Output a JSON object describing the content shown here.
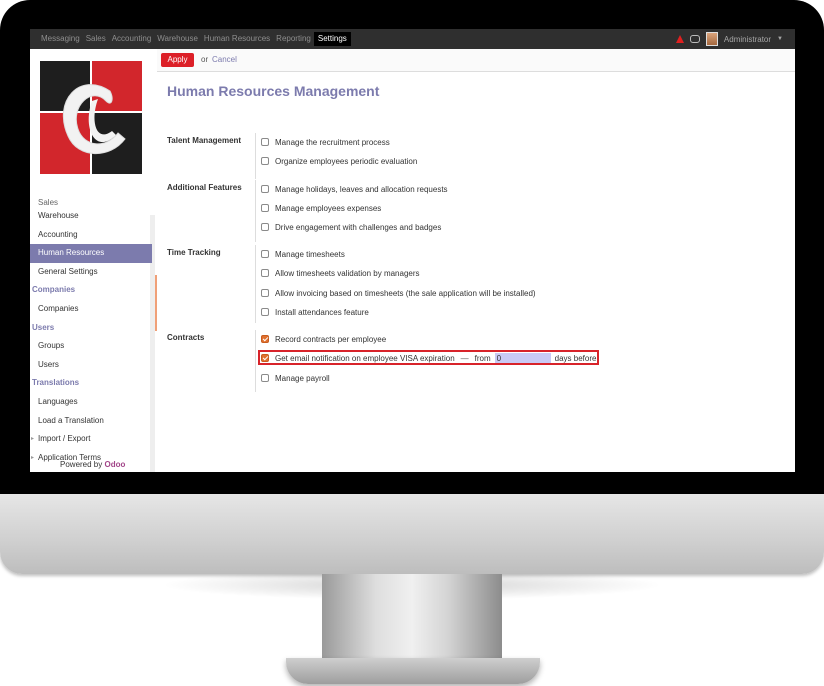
{
  "nav": {
    "menu": [
      {
        "label": "Messaging",
        "active": false
      },
      {
        "label": "Sales",
        "active": false
      },
      {
        "label": "Accounting",
        "active": false
      },
      {
        "label": "Warehouse",
        "active": false
      },
      {
        "label": "Human Resources",
        "active": false
      },
      {
        "label": "Reporting",
        "active": false
      },
      {
        "label": "Settings",
        "active": true
      }
    ],
    "user": "Administrator"
  },
  "sidebar": {
    "items": [
      {
        "label": "Sales",
        "type": "item"
      },
      {
        "label": "Warehouse",
        "type": "item"
      },
      {
        "label": "Accounting",
        "type": "item"
      },
      {
        "label": "Human Resources",
        "type": "item",
        "selected": true
      },
      {
        "label": "General Settings",
        "type": "item"
      },
      {
        "label": "Companies",
        "type": "category"
      },
      {
        "label": "Companies",
        "type": "item"
      },
      {
        "label": "Users",
        "type": "category"
      },
      {
        "label": "Groups",
        "type": "item"
      },
      {
        "label": "Users",
        "type": "item"
      },
      {
        "label": "Translations",
        "type": "category"
      },
      {
        "label": "Languages",
        "type": "item"
      },
      {
        "label": "Load a Translation",
        "type": "item"
      },
      {
        "label": "Import / Export",
        "type": "item",
        "arrow": true
      },
      {
        "label": "Application Terms",
        "type": "item",
        "arrow": true
      }
    ],
    "powered_prefix": "Powered by",
    "powered_brand": "Odoo"
  },
  "toolbar": {
    "apply_label": "Apply",
    "or_text": "or",
    "cancel_label": "Cancel"
  },
  "main": {
    "title": "Human Resources Management",
    "sections": [
      {
        "label": "Talent Management",
        "options": [
          {
            "label": "Manage the recruitment process",
            "checked": false
          },
          {
            "label": "Organize employees periodic evaluation",
            "checked": false
          }
        ]
      },
      {
        "label": "Additional Features",
        "options": [
          {
            "label": "Manage holidays, leaves and allocation requests",
            "checked": false
          },
          {
            "label": "Manage employees expenses",
            "checked": false
          },
          {
            "label": "Drive engagement with challenges and badges",
            "checked": false
          }
        ]
      },
      {
        "label": "Time Tracking",
        "options": [
          {
            "label": "Manage timesheets",
            "checked": false
          },
          {
            "label": "Allow timesheets validation by managers",
            "checked": false
          },
          {
            "label": "Allow invoicing based on timesheets (the sale application will be installed)",
            "checked": false
          },
          {
            "label": "Install attendances feature",
            "checked": false
          }
        ]
      },
      {
        "label": "Contracts",
        "options": [
          {
            "label": "Record contracts per employee",
            "checked": true
          },
          {
            "label": "Get email notification on employee VISA expiration",
            "checked": true,
            "dash": "—",
            "from_label": "from",
            "days_value": "0",
            "suffix": "days before"
          },
          {
            "label": "Manage payroll",
            "checked": false
          }
        ]
      }
    ]
  },
  "colors": {
    "accent": "#7c7bad",
    "apply": "#dc1f27",
    "checked": "#e0712f",
    "highlight": "#d8232a"
  }
}
